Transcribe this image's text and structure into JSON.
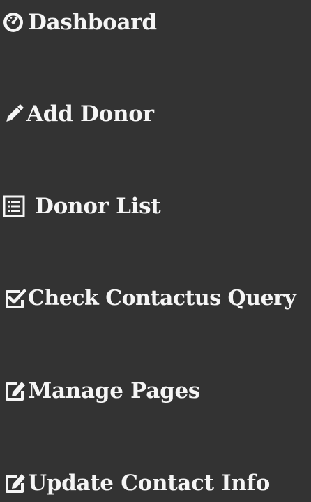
{
  "menu": {
    "items": [
      {
        "label": "Dashboard",
        "icon": "dashboard-gauge-icon"
      },
      {
        "label": "Add Donor",
        "icon": "pencil-icon"
      },
      {
        "label": "Donor List",
        "icon": "list-icon"
      },
      {
        "label": "Check Contactus Query",
        "icon": "check-square-icon"
      },
      {
        "label": "Manage Pages",
        "icon": "edit-square-icon"
      },
      {
        "label": "Update Contact Info",
        "icon": "edit-square-icon"
      }
    ]
  },
  "colors": {
    "background": "#333333",
    "text": "#f5f5f5"
  }
}
